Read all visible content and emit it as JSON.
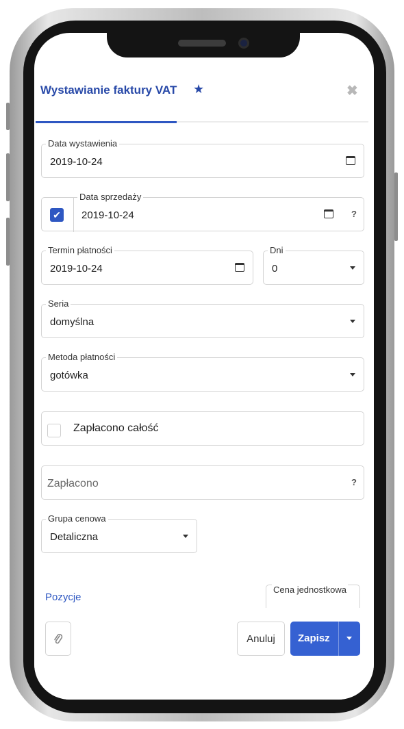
{
  "header": {
    "title": "Wystawianie faktury VAT",
    "star_icon": "★",
    "close_icon": "✖"
  },
  "form": {
    "issue_date": {
      "label": "Data wystawienia",
      "value": "2019-10-24"
    },
    "sale_date": {
      "label": "Data sprzedaży",
      "value": "2019-10-24",
      "checked": true,
      "help": "?"
    },
    "payment_due": {
      "label": "Termin płatności",
      "value": "2019-10-24"
    },
    "days": {
      "label": "Dni",
      "value": "0"
    },
    "series": {
      "label": "Seria",
      "value": "domyślna"
    },
    "payment_method": {
      "label": "Metoda płatności",
      "value": "gotówka"
    },
    "paid_in_full": {
      "label": "Zapłacono całość",
      "checked": false
    },
    "paid_amount": {
      "placeholder": "Zapłacono",
      "help": "?"
    },
    "price_group": {
      "label": "Grupa cenowa",
      "value": "Detaliczna"
    }
  },
  "positions": {
    "link": "Pozycje",
    "unit_price_header": "Cena jednostkowa"
  },
  "footer": {
    "attach_icon": "paperclip-icon",
    "cancel_label": "Anuluj",
    "save_label": "Zapisz"
  },
  "colors": {
    "accent": "#3561d2",
    "title": "#2849a8"
  }
}
